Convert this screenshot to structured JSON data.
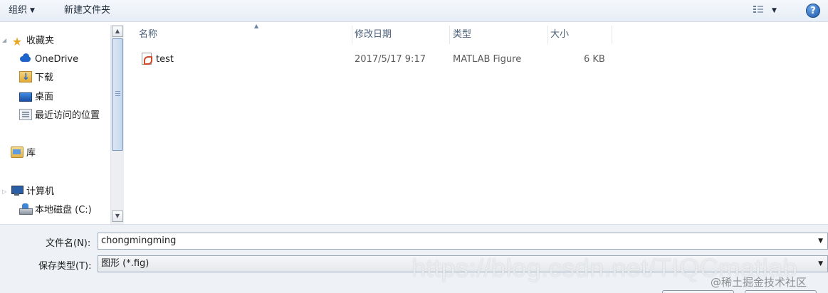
{
  "toolbar": {
    "organize_label": "组织",
    "new_folder_label": "新建文件夹"
  },
  "nav": {
    "favorites": "收藏夹",
    "items": [
      {
        "label": "OneDrive",
        "icon": "onedrive-icon"
      },
      {
        "label": "下载",
        "icon": "downloads-icon"
      },
      {
        "label": "桌面",
        "icon": "desktop-icon"
      },
      {
        "label": "最近访问的位置",
        "icon": "recent-places-icon"
      }
    ],
    "library": "库",
    "computer": "计算机",
    "drive_c": "本地磁盘 (C:)"
  },
  "columns": [
    "名称",
    "修改日期",
    "类型",
    "大小"
  ],
  "files": [
    {
      "name": "test",
      "modified": "2017/5/17 9:17",
      "type": "MATLAB Figure",
      "size": "6 KB"
    }
  ],
  "form": {
    "filename_label": "文件名(N):",
    "filename_value": "chongmingming",
    "filetype_label": "保存类型(T):",
    "filetype_value": "图形 (*.fig)"
  },
  "watermark": "https://blog.csdn.net/TIQCmatlab",
  "watermark2": "@稀土掘金技术社区"
}
